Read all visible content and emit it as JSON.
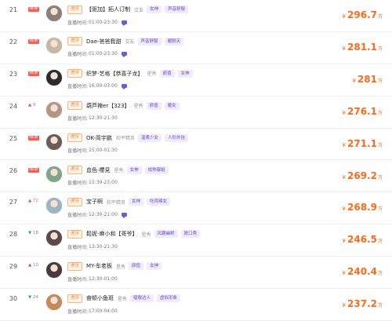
{
  "labels": {
    "live_time": "直播时间:",
    "currency": "¥",
    "unit": "万"
  },
  "colors": {
    "accent": "#ff6a1a",
    "tag_text": "#6a4cd1",
    "tag_bg": "#f0ecfb",
    "up": "#f24b4b",
    "down": "#2bb24c",
    "new": "#ff5a52"
  },
  "rows": [
    {
      "rank": "21",
      "change": {
        "type": "new",
        "text": "NEW"
      },
      "platform": "虎牙",
      "name": "【驱加】拓人订制",
      "category": "交友",
      "tags": [
        "女神",
        "声音舒服"
      ],
      "time": "01:00-23:30",
      "chat": true,
      "amount": "296.7",
      "avatar": "#8a7f78"
    },
    {
      "rank": "22",
      "change": {
        "type": "new",
        "text": "NEW"
      },
      "platform": "虎牙",
      "name": "Dae-爸爸我甜",
      "category": "交友",
      "tags": [
        "声音舒服",
        "暖聊天"
      ],
      "time": "01:00-23:30",
      "chat": true,
      "amount": "281.1",
      "avatar": "#c9b7a6"
    },
    {
      "rank": "23",
      "change": {
        "type": "new",
        "text": "NEW"
      },
      "platform": "虎牙",
      "name": "织梦-艺格【恭喜子龙】",
      "category": "星秀",
      "tags": [
        "颜值",
        "女神"
      ],
      "time": "16:00-03:00",
      "chat": true,
      "amount": "281",
      "avatar": "#2b2b2b"
    },
    {
      "rank": "24",
      "change": {
        "type": "up",
        "text": "9"
      },
      "platform": "虎牙",
      "name": "葫芦辣er【323】",
      "category": "星秀",
      "tags": [
        "颜值",
        "暖女"
      ],
      "time": "12:30-21:30",
      "chat": false,
      "amount": "276.1",
      "avatar": "#b59583"
    },
    {
      "rank": "25",
      "change": {
        "type": "new",
        "text": "NEW"
      },
      "platform": "虎牙",
      "name": "OK-简宇鹏",
      "category": "和平精英",
      "tags": [
        "温柔少女",
        "人形外挂"
      ],
      "time": "15:00-01:30",
      "chat": false,
      "amount": "271.1",
      "avatar": "#6b5c58"
    },
    {
      "rank": "26",
      "change": {
        "type": "new",
        "text": "NEW"
      },
      "platform": "虎牙",
      "name": "血色-櫻見",
      "category": "星秀",
      "tags": [
        "女神",
        "成熟御姐"
      ],
      "time": "15:30-23:00",
      "chat": false,
      "amount": "269.2",
      "avatar": "#7fa58a"
    },
    {
      "rank": "27",
      "change": {
        "type": "up",
        "text": "72"
      },
      "platform": "虎牙",
      "name": "宝子啊",
      "category": "和平精英",
      "tags": [
        "女神",
        "吃鸡辣女"
      ],
      "time": "12:30-21:00",
      "chat": true,
      "amount": "268.9",
      "avatar": "#9bb4c4"
    },
    {
      "rank": "28",
      "change": {
        "type": "down",
        "text": "18"
      },
      "platform": "虎牙",
      "name": "鬆妮-麻小和【哥爷】",
      "category": "星秀",
      "tags": [
        "风趣幽默",
        "脱口秀"
      ],
      "time": "13:30-21:30",
      "chat": false,
      "amount": "246.5",
      "avatar": "#5b4a48"
    },
    {
      "rank": "29",
      "change": {
        "type": "up",
        "text": "10"
      },
      "platform": "虎牙",
      "name": "MY-车老板",
      "category": "星秀",
      "tags": [
        "颜值",
        "女神"
      ],
      "time": "12:30-01:00",
      "chat": false,
      "amount": "240.4",
      "avatar": "#4a3a3c"
    },
    {
      "rank": "30",
      "change": {
        "type": "down",
        "text": "24"
      },
      "platform": "虎牙",
      "name": "奋顿小鱼斑",
      "category": "星秀",
      "tags": [
        "唱歌达人",
        "虚拟形象"
      ],
      "time": "17:00-04:00",
      "chat": false,
      "amount": "237.2",
      "avatar": "#c48a5a"
    }
  ]
}
